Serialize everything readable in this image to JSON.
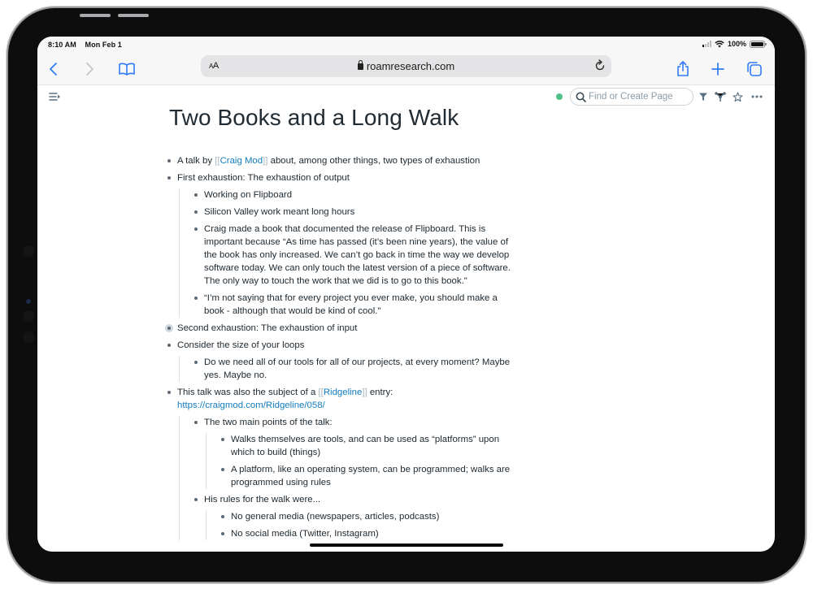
{
  "status_bar": {
    "time": "8:10 AM",
    "date": "Mon Feb 1",
    "battery_label": "100%",
    "battery_level": 1.0
  },
  "browser": {
    "text_size_label_small": "A",
    "text_size_label_large": "A",
    "url": "roamresearch.com",
    "icons": {
      "back": "chevron-left-icon",
      "forward": "chevron-right-icon",
      "bookmarks": "book-icon",
      "reload": "reload-icon",
      "share": "share-icon",
      "new_tab": "plus-icon",
      "tabs": "tabs-icon",
      "lock": "lock-icon"
    },
    "accent_color": "#2f7bf5"
  },
  "roam_toolbar": {
    "search_placeholder": "Find or Create Page",
    "sync_status_color": "#4fbf8b",
    "icons": [
      "filter-icon",
      "graph-icon",
      "star-icon",
      "more-icon"
    ]
  },
  "page": {
    "title": "Two Books and a Long Walk",
    "link_color": "#137cbd",
    "blocks": [
      {
        "pre": "A talk by ",
        "link": "Craig Mod",
        "post": " about, among other things, two types of exhaustion"
      },
      {
        "text": "First exhaustion: The exhaustion of output",
        "children": [
          "Working on Flipboard",
          "Silicon Valley work meant long hours",
          "Craig made a book that documented the release of Flipboard. This is important because “As time has passed (it’s been nine years), the value of the book has only increased. We can’t go back in time the way we develop software today. We can only touch the latest version of a piece of software. The only way to touch the work that we did is to go to this book.\"",
          "“I’m not saying that for every project you ever make, you should make a book - although that would be kind of cool.\""
        ]
      },
      {
        "text": "Second exhaustion: The exhaustion of input",
        "collapsed": true
      },
      {
        "text": "Consider the size of your loops",
        "children": [
          "Do we need all of our tools for all of our projects, at every moment? Maybe yes. Maybe no."
        ]
      },
      {
        "pre": "This talk was also the subject of a ",
        "link": "Ridgeline",
        "post": " entry:",
        "url": "https://craigmod.com/Ridgeline/058/",
        "children": [
          {
            "text": "The two main points of the talk:",
            "children": [
              "Walks themselves are tools, and can be used as “platforms” upon which to build (things)",
              "A platform, like an operating system, can be programmed; walks are programmed using rules"
            ]
          },
          {
            "text": "His rules for the walk were...",
            "children": [
              "No general media (newspapers, articles, podcasts)",
              "No social media (Twitter, Instagram)"
            ]
          }
        ]
      }
    ]
  }
}
